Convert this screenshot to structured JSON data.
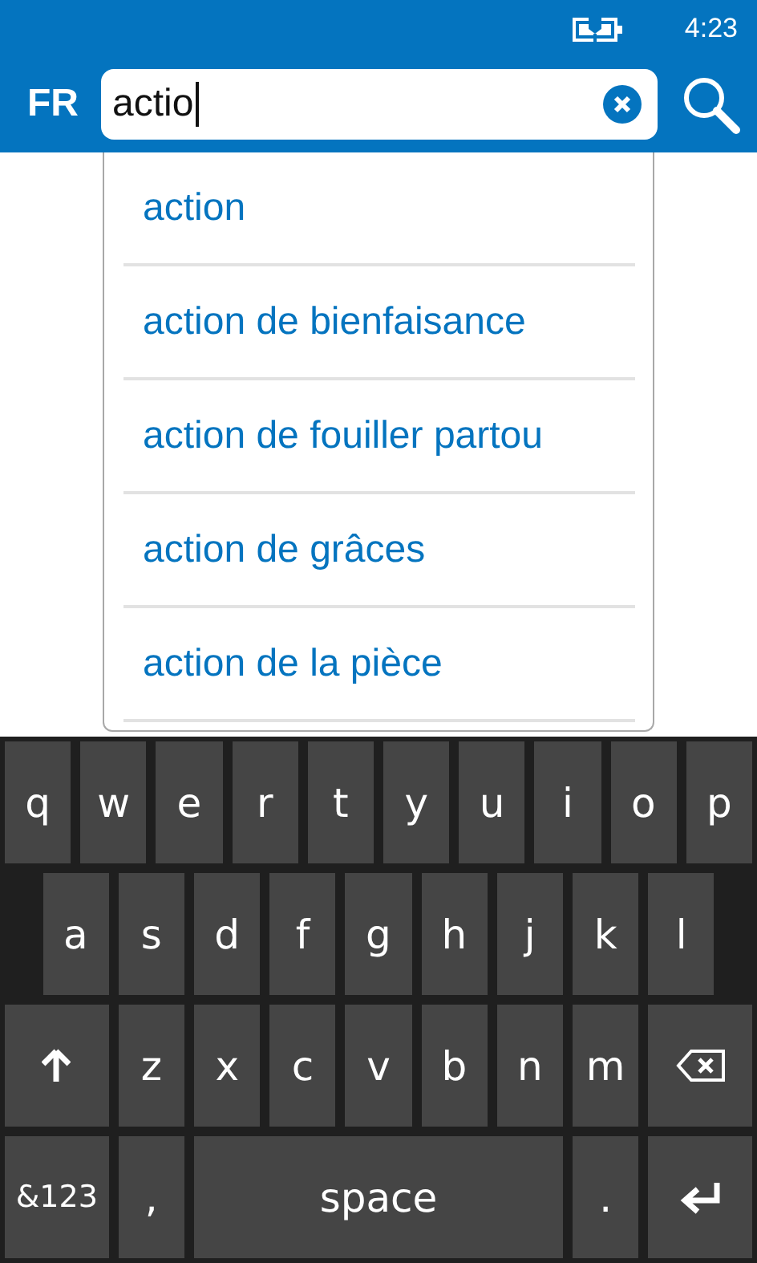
{
  "status_bar": {
    "time": "4:23"
  },
  "header": {
    "language": "FR",
    "search": {
      "value": "actio",
      "focused": true
    }
  },
  "suggestions": [
    "action",
    "action de bienfaisance",
    "action de fouiller partou",
    "action de grâces",
    "action de la pièce"
  ],
  "keyboard": {
    "key_rows": [
      {
        "keys": [
          {
            "kind": "char",
            "label": "q"
          },
          {
            "kind": "char",
            "label": "w"
          },
          {
            "kind": "char",
            "label": "e"
          },
          {
            "kind": "char",
            "label": "r"
          },
          {
            "kind": "char",
            "label": "t"
          },
          {
            "kind": "char",
            "label": "y"
          },
          {
            "kind": "char",
            "label": "u"
          },
          {
            "kind": "char",
            "label": "i"
          },
          {
            "kind": "char",
            "label": "o"
          },
          {
            "kind": "char",
            "label": "p"
          }
        ]
      },
      {
        "keys": [
          {
            "kind": "char",
            "label": "a"
          },
          {
            "kind": "char",
            "label": "s"
          },
          {
            "kind": "char",
            "label": "d"
          },
          {
            "kind": "char",
            "label": "f"
          },
          {
            "kind": "char",
            "label": "g"
          },
          {
            "kind": "char",
            "label": "h"
          },
          {
            "kind": "char",
            "label": "j"
          },
          {
            "kind": "char",
            "label": "k"
          },
          {
            "kind": "char",
            "label": "l"
          }
        ]
      },
      {
        "keys": [
          {
            "kind": "shift"
          },
          {
            "kind": "char",
            "label": "z"
          },
          {
            "kind": "char",
            "label": "x"
          },
          {
            "kind": "char",
            "label": "c"
          },
          {
            "kind": "char",
            "label": "v"
          },
          {
            "kind": "char",
            "label": "b"
          },
          {
            "kind": "char",
            "label": "n"
          },
          {
            "kind": "char",
            "label": "m"
          },
          {
            "kind": "backspace"
          }
        ]
      },
      {
        "keys": [
          {
            "kind": "symbols",
            "label": "&123"
          },
          {
            "kind": "char",
            "label": ","
          },
          {
            "kind": "space",
            "label": "space"
          },
          {
            "kind": "char",
            "label": "."
          },
          {
            "kind": "enter"
          }
        ]
      }
    ]
  }
}
